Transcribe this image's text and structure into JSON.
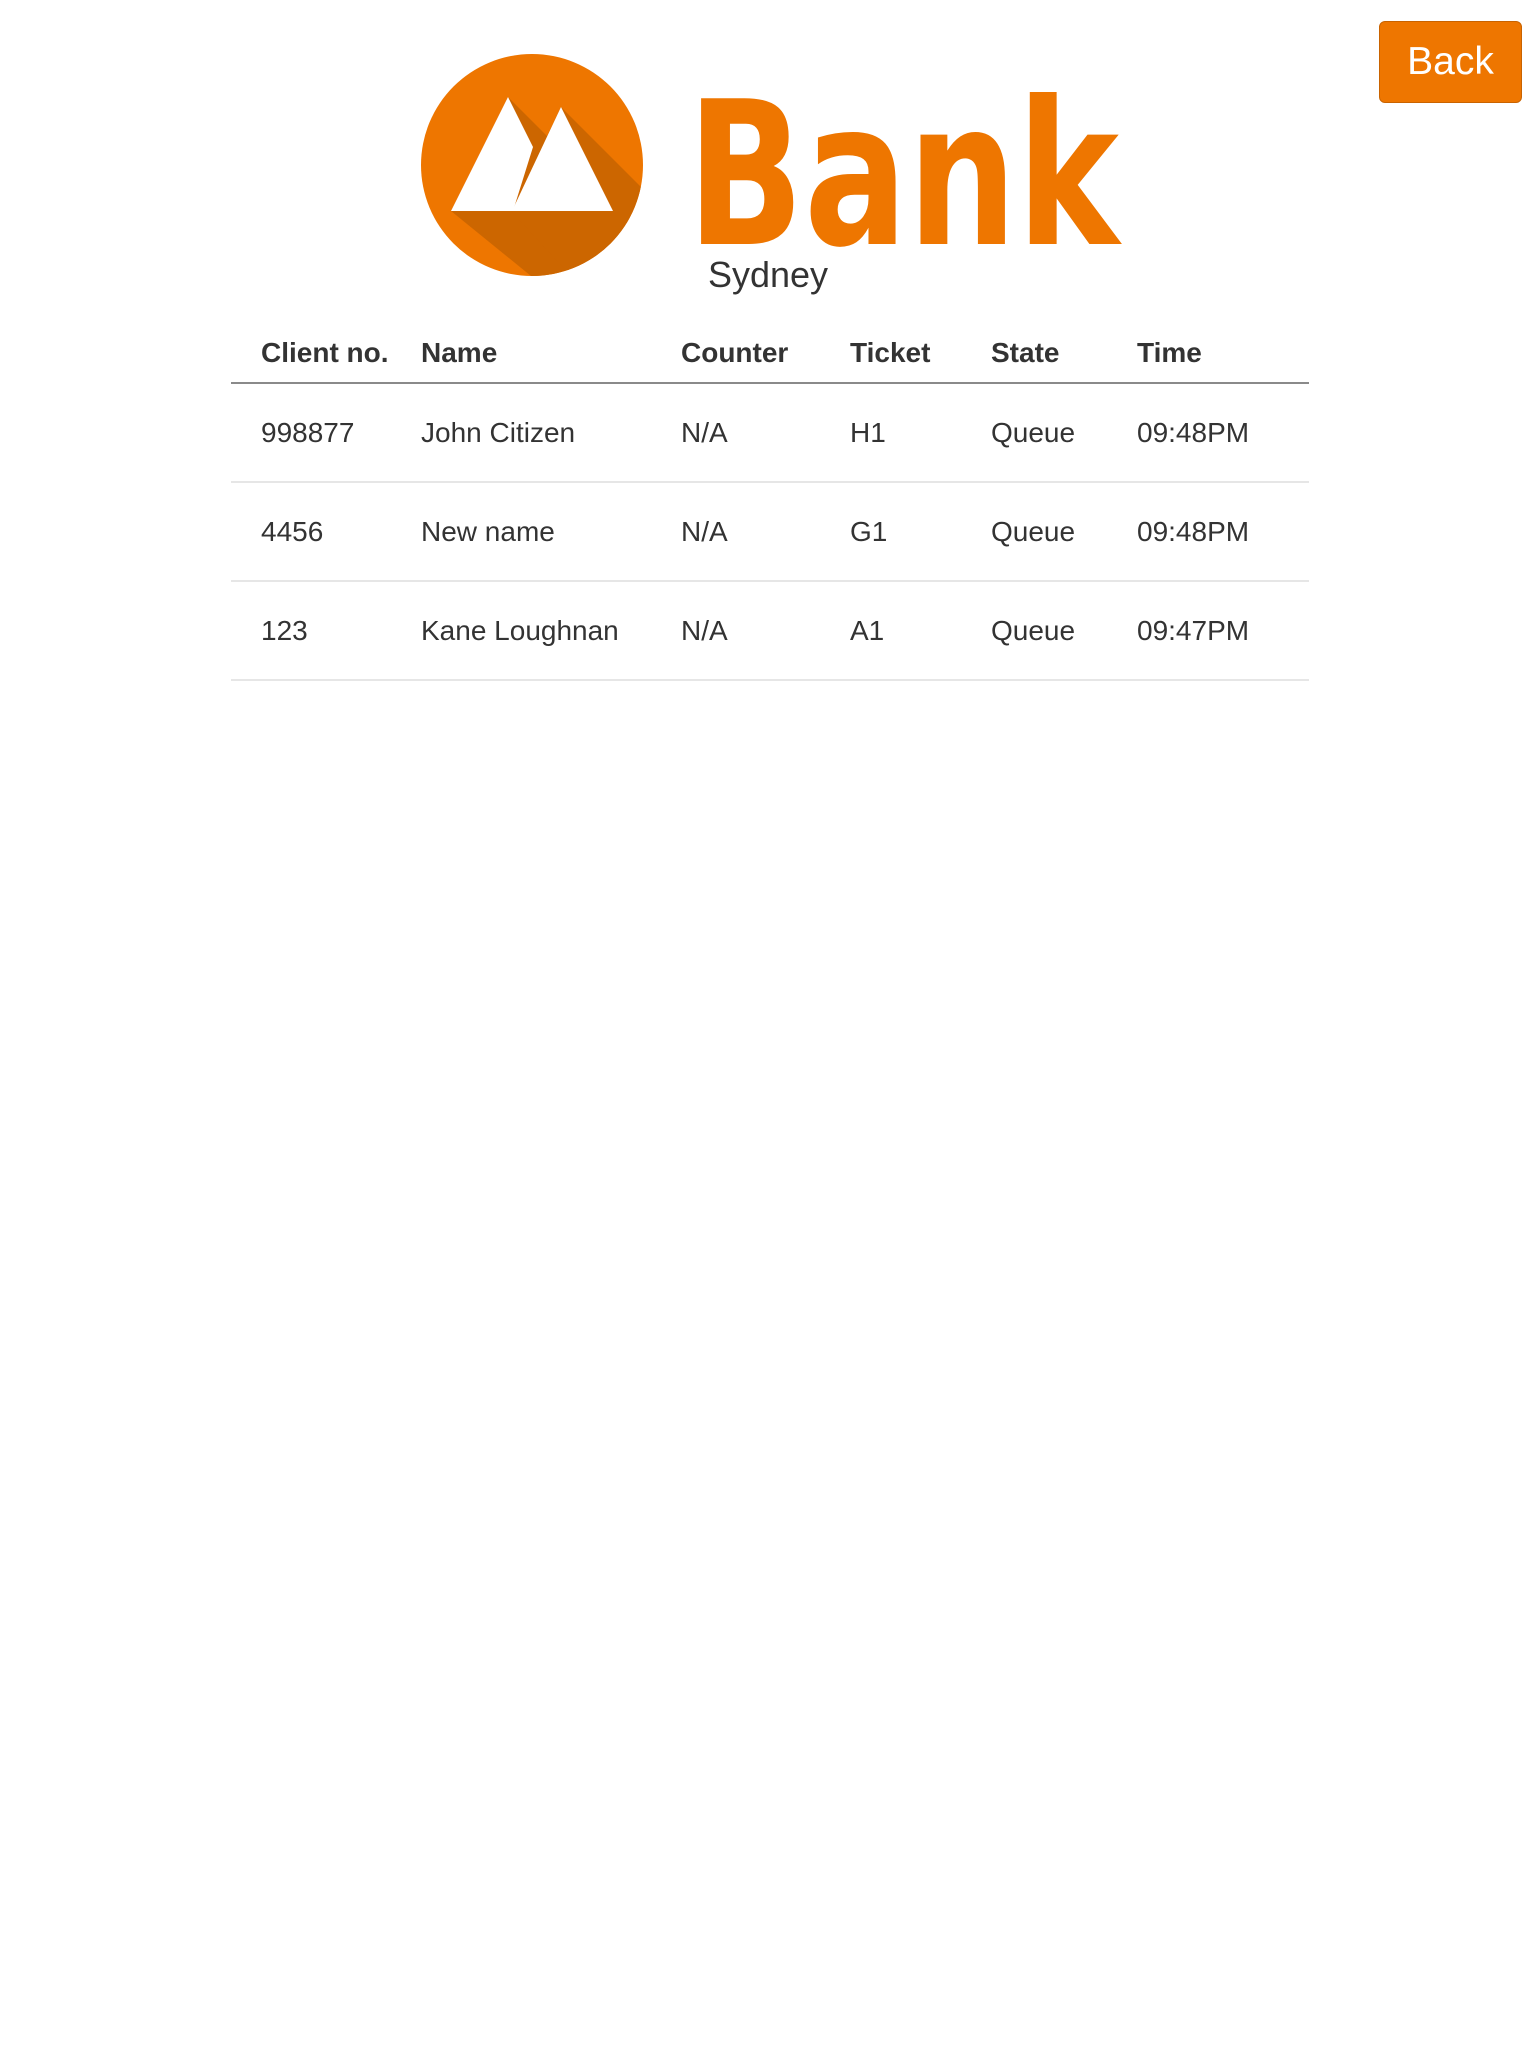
{
  "header": {
    "back_label": "Back",
    "logo_text": "Bank",
    "branch": "Sydney"
  },
  "table": {
    "columns": [
      "Client no.",
      "Name",
      "Counter",
      "Ticket",
      "State",
      "Time"
    ],
    "rows": [
      {
        "client_no": "998877",
        "name": "John Citizen",
        "counter": "N/A",
        "ticket": "H1",
        "state": "Queue",
        "time": "09:48PM"
      },
      {
        "client_no": "4456",
        "name": "New name",
        "counter": "N/A",
        "ticket": "G1",
        "state": "Queue",
        "time": "09:48PM"
      },
      {
        "client_no": "123",
        "name": "Kane Loughnan",
        "counter": "N/A",
        "ticket": "A1",
        "state": "Queue",
        "time": "09:47PM"
      }
    ]
  },
  "colors": {
    "accent": "#ee7600",
    "accent_dark": "#cc6600",
    "text": "#333333"
  },
  "icons": {
    "logo_mark": "mountain-circle-icon",
    "back": "none"
  }
}
